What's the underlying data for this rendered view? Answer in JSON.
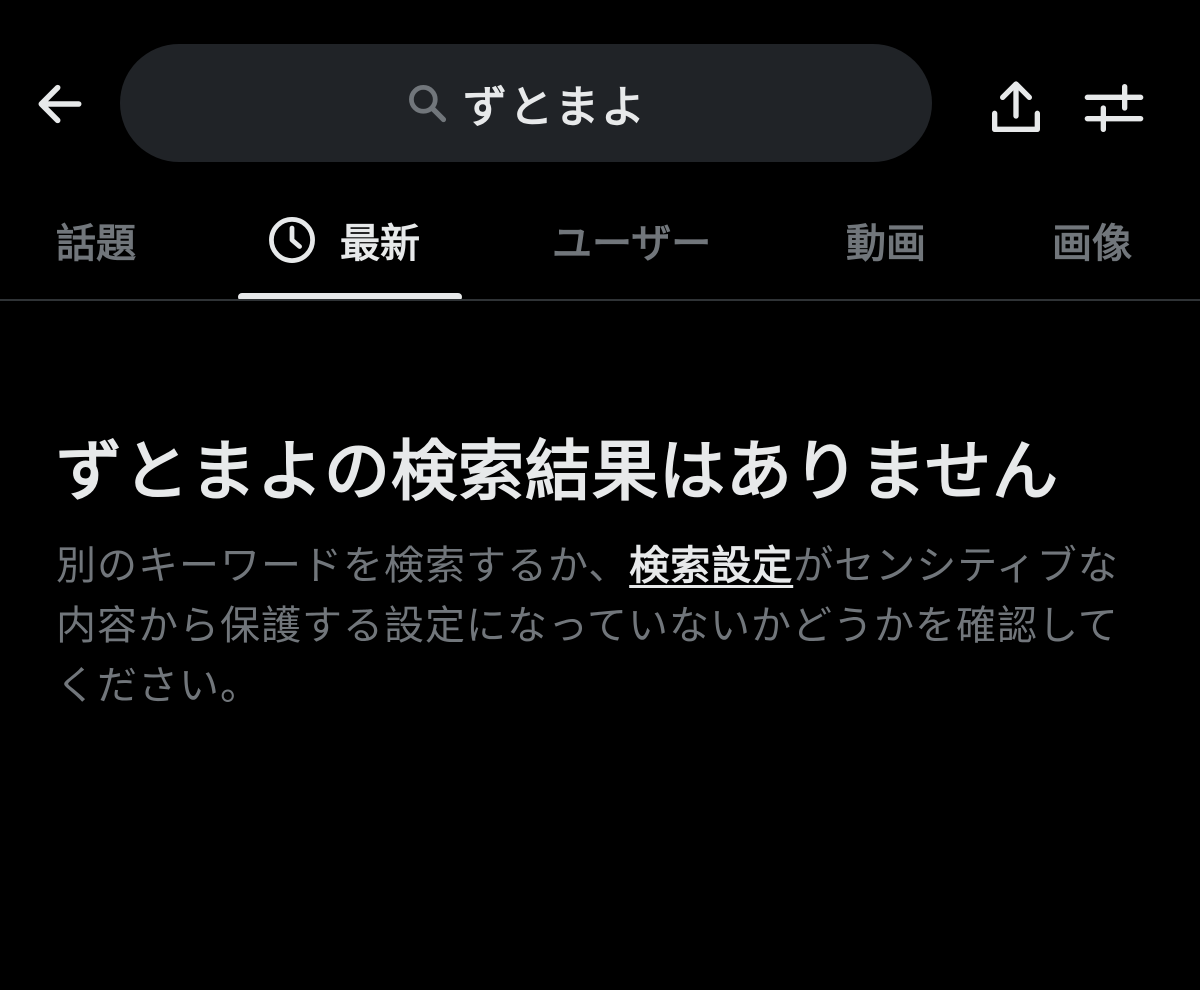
{
  "header": {
    "back_icon": "arrow-left-icon",
    "search_query": "ずとまよ",
    "search_icon": "search-icon",
    "share_icon": "share-upload-icon",
    "filter_icon": "sliders-filter-icon"
  },
  "tabs": [
    {
      "label": "話題",
      "active": false
    },
    {
      "label": "最新",
      "active": true,
      "icon": "clock-icon"
    },
    {
      "label": "ユーザー",
      "active": false
    },
    {
      "label": "動画",
      "active": false
    },
    {
      "label": "画像",
      "active": false
    }
  ],
  "empty_state": {
    "title": "ずとまよの検索結果はありません",
    "desc_before": "別のキーワードを検索するか、",
    "desc_link": "検索設定",
    "desc_after": "がセンシティブな内容から保護する設定になっていないかどうかを確認してください。"
  },
  "colors": {
    "background": "#000000",
    "text_primary": "#e7e9ea",
    "text_secondary": "#71767b",
    "search_bg": "#202327",
    "divider": "#2f3336"
  }
}
